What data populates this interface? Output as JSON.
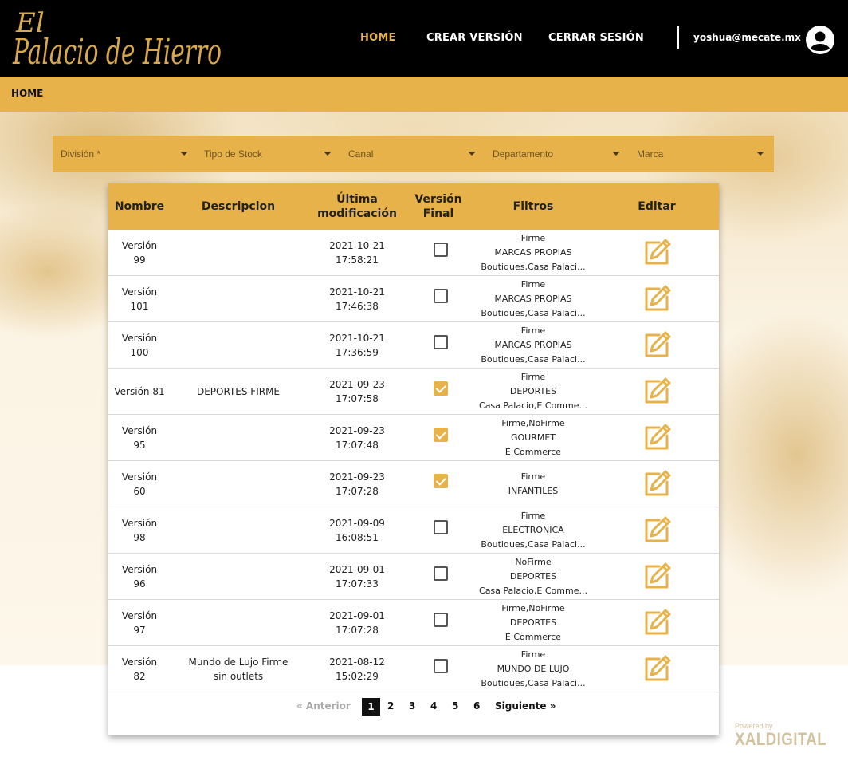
{
  "header": {
    "logo_text": "El Palacio de Hierro",
    "nav": {
      "home": "HOME",
      "crear": "CREAR VERSIÓN",
      "cerrar": "CERRAR SESIÓN"
    },
    "user_email": "yoshua@mecate.mx"
  },
  "breadcrumb": "HOME",
  "filters": [
    {
      "label": "División *"
    },
    {
      "label": "Tipo de Stock"
    },
    {
      "label": "Canal"
    },
    {
      "label": "Departamento"
    },
    {
      "label": "Marca"
    }
  ],
  "table": {
    "headers": {
      "nombre": "Nombre",
      "descripcion": "Descripcion",
      "modificacion_1": "Última",
      "modificacion_2": "modificación",
      "version_1": "Versión",
      "version_2": "Final",
      "filtros": "Filtros",
      "editar": "Editar"
    },
    "rows": [
      {
        "name1": "Versión",
        "name2": "99",
        "desc1": "",
        "desc2": "",
        "date": "2021-10-21",
        "time": "17:58:21",
        "final": false,
        "f1": "Firme",
        "f2": "MARCAS PROPIAS",
        "f3": "Boutiques,Casa Palaci..."
      },
      {
        "name1": "Versión",
        "name2": "101",
        "desc1": "",
        "desc2": "",
        "date": "2021-10-21",
        "time": "17:46:38",
        "final": false,
        "f1": "Firme",
        "f2": "MARCAS PROPIAS",
        "f3": "Boutiques,Casa Palaci..."
      },
      {
        "name1": "Versión",
        "name2": "100",
        "desc1": "",
        "desc2": "",
        "date": "2021-10-21",
        "time": "17:36:59",
        "final": false,
        "f1": "Firme",
        "f2": "MARCAS PROPIAS",
        "f3": "Boutiques,Casa Palaci..."
      },
      {
        "name1": "Versión 81",
        "name2": "",
        "desc1": "DEPORTES FIRME",
        "desc2": "",
        "date": "2021-09-23",
        "time": "17:07:58",
        "final": true,
        "f1": "Firme",
        "f2": "DEPORTES",
        "f3": "Casa Palacio,E Comme..."
      },
      {
        "name1": "Versión",
        "name2": "95",
        "desc1": "",
        "desc2": "",
        "date": "2021-09-23",
        "time": "17:07:48",
        "final": true,
        "f1": "Firme,NoFirme",
        "f2": "GOURMET",
        "f3": "E Commerce"
      },
      {
        "name1": "Versión",
        "name2": "60",
        "desc1": "",
        "desc2": "",
        "date": "2021-09-23",
        "time": "17:07:28",
        "final": true,
        "f1": "Firme",
        "f2": "INFANTILES",
        "f3": ""
      },
      {
        "name1": "Versión",
        "name2": "98",
        "desc1": "",
        "desc2": "",
        "date": "2021-09-09",
        "time": "16:08:51",
        "final": false,
        "f1": "Firme",
        "f2": "ELECTRONICA",
        "f3": "Boutiques,Casa Palaci..."
      },
      {
        "name1": "Versión",
        "name2": "96",
        "desc1": "",
        "desc2": "",
        "date": "2021-09-01",
        "time": "17:07:33",
        "final": false,
        "f1": "NoFirme",
        "f2": "DEPORTES",
        "f3": "Casa Palacio,E Comme..."
      },
      {
        "name1": "Versión",
        "name2": "97",
        "desc1": "",
        "desc2": "",
        "date": "2021-09-01",
        "time": "17:07:28",
        "final": false,
        "f1": "Firme,NoFirme",
        "f2": "DEPORTES",
        "f3": "E Commerce"
      },
      {
        "name1": "Versión",
        "name2": "82",
        "desc1": "Mundo de Lujo Firme",
        "desc2": "sin outlets",
        "date": "2021-08-12",
        "time": "15:02:29",
        "final": false,
        "f1": "Firme",
        "f2": "MUNDO DE LUJO",
        "f3": "Boutiques,Casa Palaci..."
      }
    ]
  },
  "pagination": {
    "prev": "«  Anterior",
    "pages": [
      "1",
      "2",
      "3",
      "4",
      "5",
      "6"
    ],
    "current": "1",
    "next": "Siguiente  »"
  },
  "powered": {
    "small": "Powered by",
    "big": "XALDIGITAL"
  },
  "colors": {
    "accent": "#e8b24a",
    "header_bg": "#000000"
  }
}
